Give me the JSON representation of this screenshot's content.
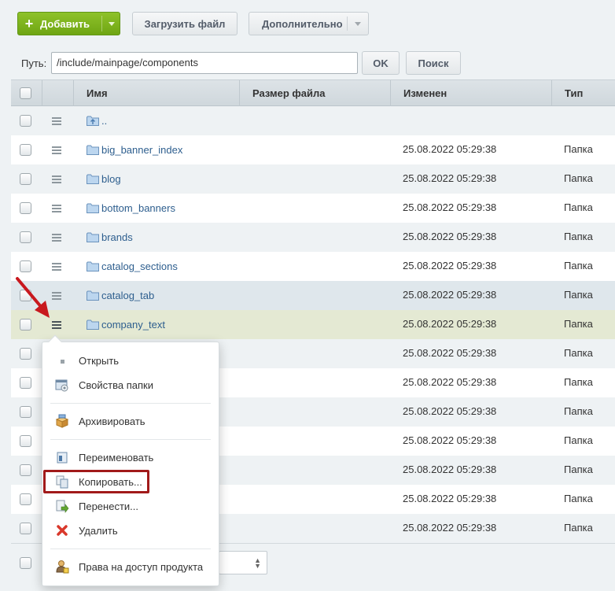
{
  "toolbar": {
    "add_label": "Добавить",
    "upload_label": "Загрузить файл",
    "more_label": "Дополнительно"
  },
  "pathbar": {
    "label": "Путь:",
    "value": "/include/mainpage/components",
    "ok_label": "OK",
    "search_label": "Поиск"
  },
  "table": {
    "columns": [
      "Имя",
      "Размер файла",
      "Изменен",
      "Тип"
    ],
    "rows": [
      {
        "name": "..",
        "date": "",
        "type": ""
      },
      {
        "name": "big_banner_index",
        "date": "25.08.2022 05:29:38",
        "type": "Папка"
      },
      {
        "name": "blog",
        "date": "25.08.2022 05:29:38",
        "type": "Папка"
      },
      {
        "name": "bottom_banners",
        "date": "25.08.2022 05:29:38",
        "type": "Папка"
      },
      {
        "name": "brands",
        "date": "25.08.2022 05:29:38",
        "type": "Папка"
      },
      {
        "name": "catalog_sections",
        "date": "25.08.2022 05:29:38",
        "type": "Папка"
      },
      {
        "name": "catalog_tab",
        "date": "25.08.2022 05:29:38",
        "type": "Папка"
      },
      {
        "name": "company_text",
        "date": "25.08.2022 05:29:38",
        "type": "Папка"
      },
      {
        "name": "",
        "date": "25.08.2022 05:29:38",
        "type": "Папка"
      },
      {
        "name": "",
        "date": "25.08.2022 05:29:38",
        "type": "Папка"
      },
      {
        "name": "",
        "date": "25.08.2022 05:29:38",
        "type": "Папка"
      },
      {
        "name": "",
        "date": "25.08.2022 05:29:38",
        "type": "Папка"
      },
      {
        "name": "",
        "date": "25.08.2022 05:29:38",
        "type": "Папка"
      },
      {
        "name": "",
        "date": "25.08.2022 05:29:38",
        "type": "Папка"
      },
      {
        "name": "",
        "date": "25.08.2022 05:29:38",
        "type": "Папка"
      }
    ]
  },
  "context_menu": {
    "items": [
      {
        "label": "Открыть",
        "icon": "dot-icon"
      },
      {
        "label": "Свойства папки",
        "icon": "folder-properties-icon"
      },
      {
        "label": "Архивировать",
        "icon": "archive-box-icon"
      },
      {
        "label": "Переименовать",
        "icon": "rename-icon"
      },
      {
        "label": "Копировать...",
        "icon": "copy-icon"
      },
      {
        "label": "Перенести...",
        "icon": "move-icon"
      },
      {
        "label": "Удалить",
        "icon": "delete-x-icon"
      },
      {
        "label": "Права на доступ продукта",
        "icon": "user-access-icon"
      }
    ]
  },
  "colors": {
    "add_button": "#7ab51d",
    "link": "#2d5e8e",
    "highlight": "#a11a1a",
    "active_row": "#e4e9d3"
  }
}
